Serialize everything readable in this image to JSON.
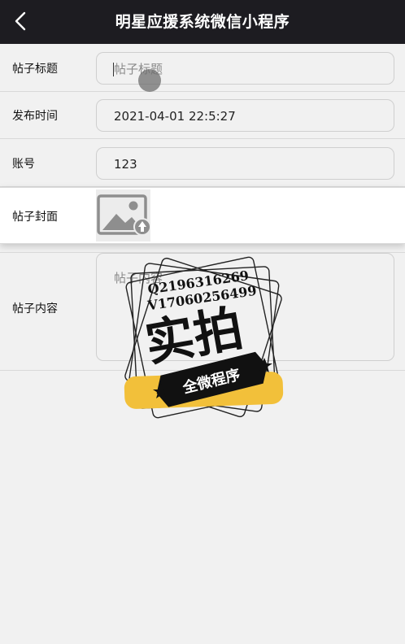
{
  "nav": {
    "title": "明星应援系统微信小程序",
    "back_icon": "chevron-left-icon"
  },
  "form": {
    "post_title": {
      "label": "帖子标题",
      "placeholder": "帖子标题",
      "value": ""
    },
    "publish_time": {
      "label": "发布时间",
      "value": "2021-04-01 22:5:27"
    },
    "account": {
      "label": "账号",
      "value": "123"
    },
    "cover": {
      "label": "帖子封面",
      "icon": "image-upload-icon"
    },
    "content": {
      "label": "帖子内容",
      "placeholder": "帖子内容",
      "value": ""
    }
  },
  "watermark": {
    "line1": "Q2196316269",
    "line2": "V17060256499",
    "big_text": "实拍",
    "ribbon_text": "全微程序",
    "ribbon_color": "#f2c03a"
  },
  "colors": {
    "nav_bg": "#1d1c21",
    "page_bg": "#f1f1f1"
  }
}
